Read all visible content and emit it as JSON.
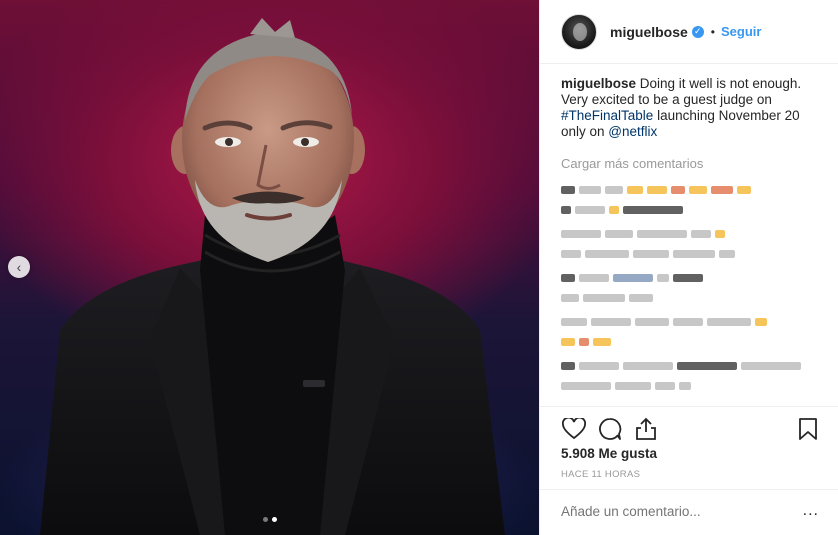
{
  "post": {
    "image_alt": "Photo of man in black turtleneck and black jacket on a TV set",
    "carousel": {
      "total": 2,
      "active": 2
    }
  },
  "header": {
    "username": "miguelbose",
    "verified_icon": "verified-badge-icon",
    "separator": "•",
    "follow_label": "Seguir"
  },
  "caption": {
    "username": "miguelbose",
    "text_1": " Doing it well is not enough. Very excited to be a guest judge on ",
    "hashtag": "#TheFinalTable",
    "text_2": " launching November 20 only on ",
    "mention": "@netflix"
  },
  "comments": {
    "load_more_label": "Cargar más comentarios"
  },
  "actions": {
    "like_icon": "heart-icon",
    "comment_icon": "comment-bubble-icon",
    "share_icon": "share-icon",
    "save_icon": "bookmark-icon"
  },
  "likes_label": "5.908 Me gusta",
  "timestamp": "HACE 11 HORAS",
  "add_comment": {
    "placeholder": "Añade un comentario...",
    "more_label": "..."
  },
  "colors": {
    "link_blue": "#3897f0",
    "tag_blue": "#003569",
    "muted_gray": "#999999"
  }
}
